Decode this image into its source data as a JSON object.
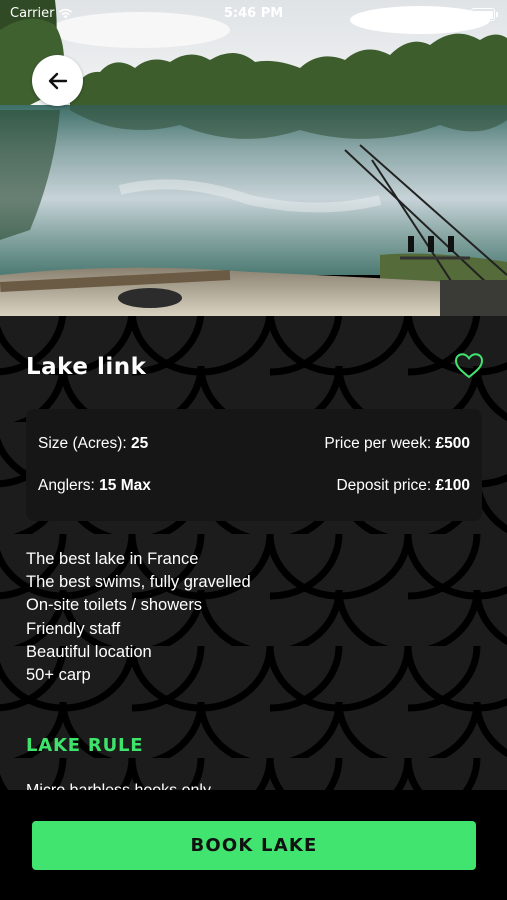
{
  "status_bar": {
    "carrier": "Carrier",
    "time": "5:46 PM"
  },
  "header": {
    "back_icon": "arrow-left-icon"
  },
  "lake": {
    "name": "Lake link",
    "favorite_icon": "heart-outline-icon"
  },
  "details": {
    "size_label": "Size (Acres): ",
    "size_value": "25",
    "price_week_label": "Price per week: ",
    "price_week_value": "£500",
    "anglers_label": "Anglers: ",
    "anglers_value": "15 Max",
    "deposit_label": "Deposit price: ",
    "deposit_value": "£100"
  },
  "features": [
    "The best lake in France",
    "The best swims,  fully gravelled",
    "On-site toilets / showers",
    "Friendly staff",
    "Beautiful location",
    "50+ carp"
  ],
  "rules": {
    "heading": "LAKE RULE",
    "first_line": "Micro barbless hooks only"
  },
  "footer": {
    "book_label": "BOOK LAKE"
  },
  "colors": {
    "accent": "#41e46f",
    "background": "#1c1c1c"
  }
}
